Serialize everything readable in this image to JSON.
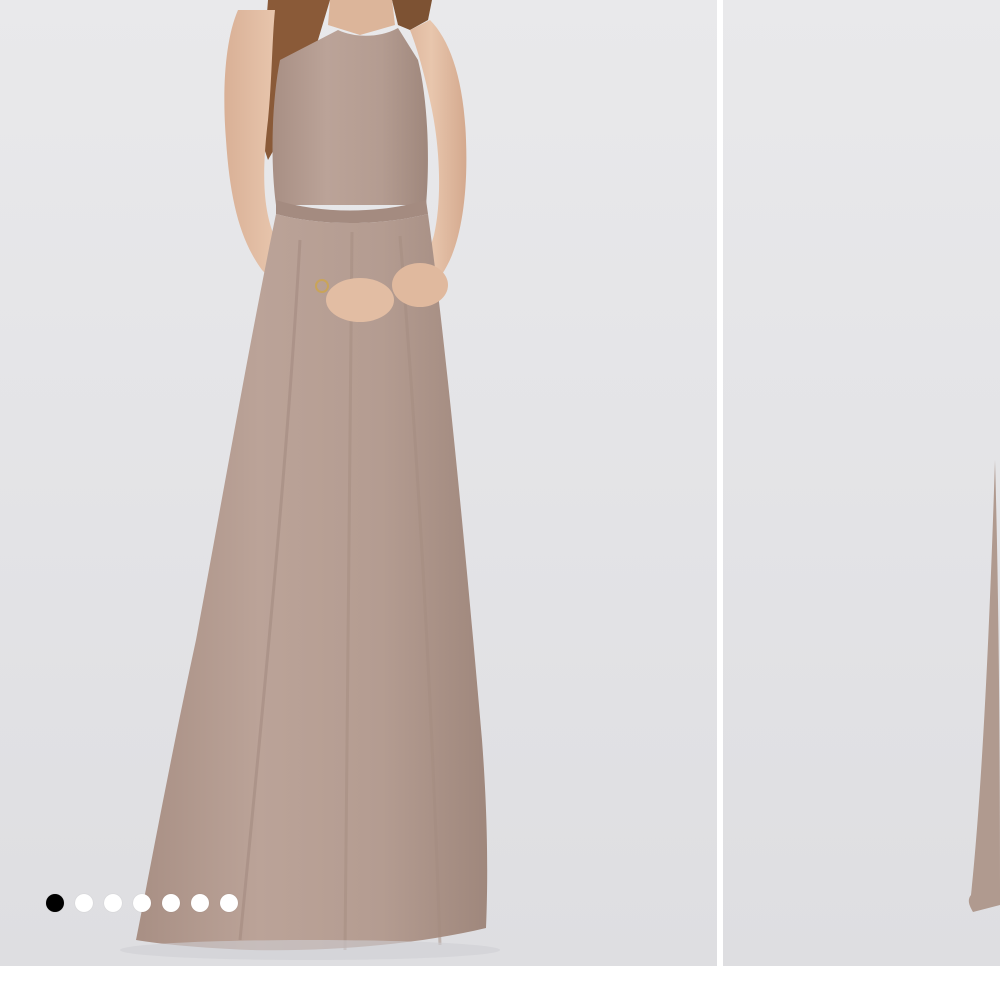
{
  "carousel": {
    "slide_count": 7,
    "active_index": 0,
    "dots": [
      {
        "active": true
      },
      {
        "active": false
      },
      {
        "active": false
      },
      {
        "active": false
      },
      {
        "active": false
      },
      {
        "active": false
      },
      {
        "active": false
      }
    ]
  },
  "product": {
    "dress_color": "#b59d92",
    "dress_shadow_color": "#a48b80",
    "skin_color": "#e2bda3",
    "hair_color": "#8a5a38"
  },
  "background_color": "#e6e6e9",
  "dot_active_color": "#000000",
  "dot_inactive_color": "#ffffff"
}
